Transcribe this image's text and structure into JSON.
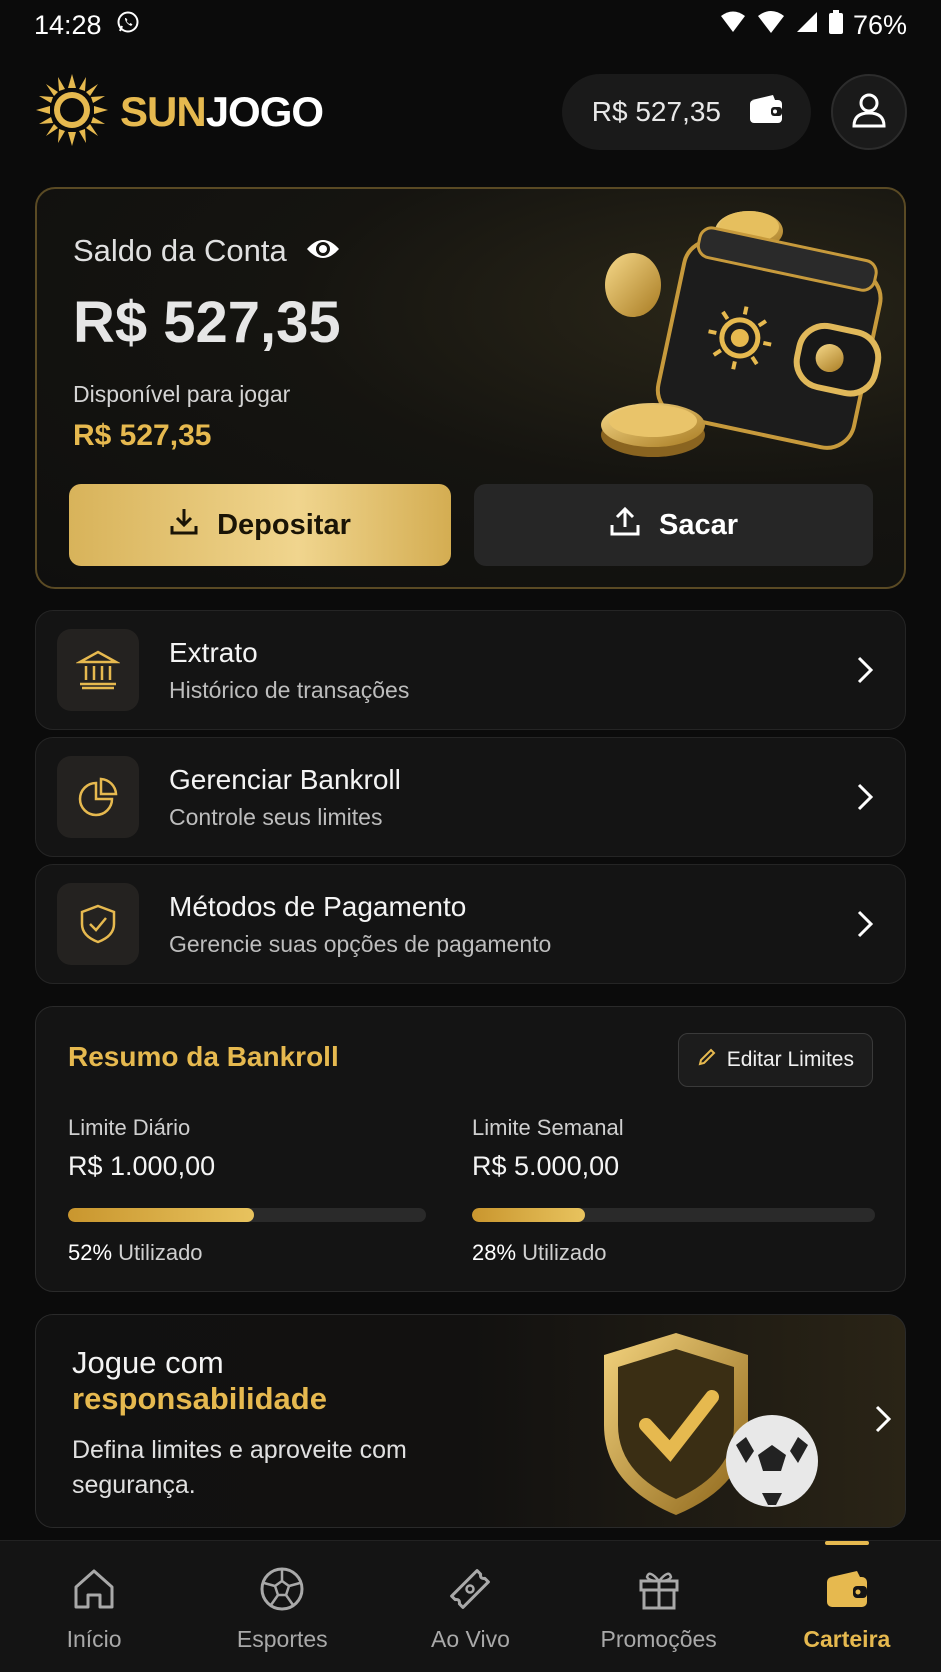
{
  "status_bar": {
    "time": "14:28",
    "battery": "76%"
  },
  "header": {
    "logo_sun": "SUN",
    "logo_jogo": "JOGO",
    "balance": "R$ 527,35"
  },
  "balance_card": {
    "label": "Saldo da Conta",
    "amount": "R$ 527,35",
    "available_label": "Disponível para jogar",
    "available_amount": "R$ 527,35",
    "deposit_label": "Depositar",
    "withdraw_label": "Sacar"
  },
  "menu": [
    {
      "title": "Extrato",
      "subtitle": "Histórico de transações",
      "icon": "bank-icon"
    },
    {
      "title": "Gerenciar Bankroll",
      "subtitle": "Controle seus limites",
      "icon": "pie-chart-icon"
    },
    {
      "title": "Métodos de Pagamento",
      "subtitle": "Gerencie suas opções de pagamento",
      "icon": "shield-check-icon"
    }
  ],
  "bankroll": {
    "title": "Resumo da Bankroll",
    "edit_label": "Editar Limites",
    "daily": {
      "label": "Limite Diário",
      "value": "R$ 1.000,00",
      "percent": 52,
      "percent_text": "52%",
      "used_label": "Utilizado"
    },
    "weekly": {
      "label": "Limite Semanal",
      "value": "R$ 5.000,00",
      "percent": 28,
      "percent_text": "28%",
      "used_label": "Utilizado"
    }
  },
  "promo": {
    "title_line1": "Jogue com",
    "title_highlight": "responsabilidade",
    "text": "Defina limites e aproveite com segurança."
  },
  "nav": [
    {
      "label": "Início",
      "icon": "home-icon",
      "active": false
    },
    {
      "label": "Esportes",
      "icon": "soccer-ball-icon",
      "active": false
    },
    {
      "label": "Ao Vivo",
      "icon": "ticket-icon",
      "active": false
    },
    {
      "label": "Promoções",
      "icon": "gift-icon",
      "active": false
    },
    {
      "label": "Carteira",
      "icon": "wallet-icon",
      "active": true
    }
  ],
  "colors": {
    "accent": "#e6b94f",
    "background": "#0b0b0b",
    "card": "#141414"
  }
}
